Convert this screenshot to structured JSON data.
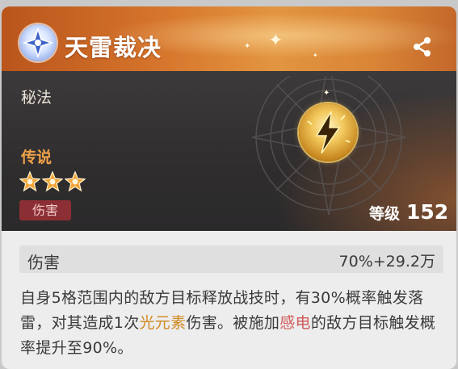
{
  "header": {
    "title": "天雷裁决",
    "emblem_icon": "star-emblem-icon",
    "share_icon": "share-icon"
  },
  "hero": {
    "type": "秘法",
    "rarity": "传说",
    "stars": 3,
    "tag": "伤害",
    "level_label": "等级",
    "level_value": "152",
    "orb_icon": "lightning-orb-icon"
  },
  "stat": {
    "name": "伤害",
    "value": "70%+29.2万"
  },
  "description": {
    "part1": "自身5格范围内的敌方目标释放战技时，有30%概率触发落雷，对其造成1次",
    "highlight1": "光元素",
    "part2": "伤害。被施加",
    "highlight2": "感电",
    "part3": "的敌方目标触发概率提升至90%。"
  },
  "colors": {
    "header_orange": "#d6752c",
    "rarity_orange": "#f0a24a",
    "tag_red": "#8c2f34",
    "light_element": "#d08a22",
    "shock_status": "#d25a5a"
  }
}
